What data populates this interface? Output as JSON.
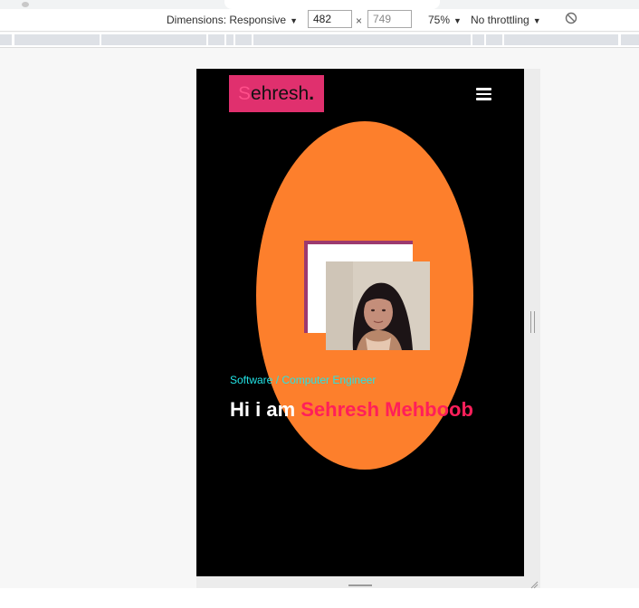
{
  "devtools": {
    "dimensions_label": "Dimensions: Responsive",
    "width_value": "482",
    "height_value": "749",
    "times_symbol": "×",
    "zoom_label": "75%",
    "throttle_label": "No throttling",
    "dropdown_arrow": "▼"
  },
  "page": {
    "logo_first_letter": "S",
    "logo_rest": "ehresh",
    "logo_dot": ".",
    "subtitle": "Software / Computer Engineer",
    "greeting": "Hi i am ",
    "name": "Sehresh Mehboob"
  },
  "colors": {
    "logo_bg": "#e0306e",
    "blob": "#fd7f2c",
    "subtitle": "#22e4e6",
    "name": "#ff1f5a",
    "page_bg": "#000000"
  },
  "icons": [
    "menu-icon",
    "rotate-icon"
  ]
}
